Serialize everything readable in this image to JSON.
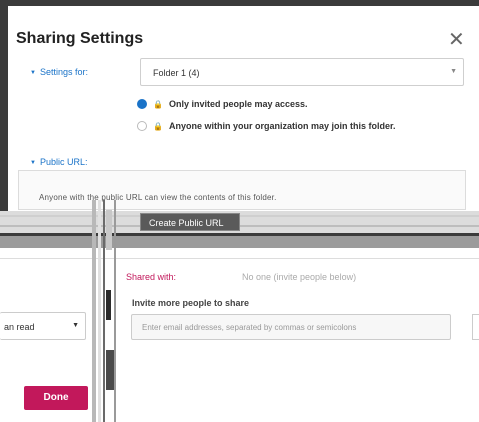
{
  "dialog": {
    "title": "Sharing Settings",
    "close_icon": "close-icon",
    "settings_for_label": "Settings for:",
    "folder_select_value": "Folder 1 (4)",
    "options": [
      {
        "label": "Only invited people may access.",
        "selected": true
      },
      {
        "label": "Anyone within your organization may join this folder.",
        "selected": false
      }
    ],
    "public_url_label": "Public URL:",
    "public_url_text": "Anyone with the public URL can view the contents of this folder."
  },
  "create_public_url_label": "Create Public URL",
  "lower": {
    "shared_with_label": "Shared with:",
    "no_one_text": "No one (invite people below)",
    "invite_label": "Invite more people to share",
    "invite_placeholder": "Enter email addresses, separated by commas or semicolons",
    "permission_value": "an read",
    "done_label": "Done"
  },
  "colors": {
    "accent_blue": "#1a73c8",
    "accent_magenta": "#c2185b"
  }
}
